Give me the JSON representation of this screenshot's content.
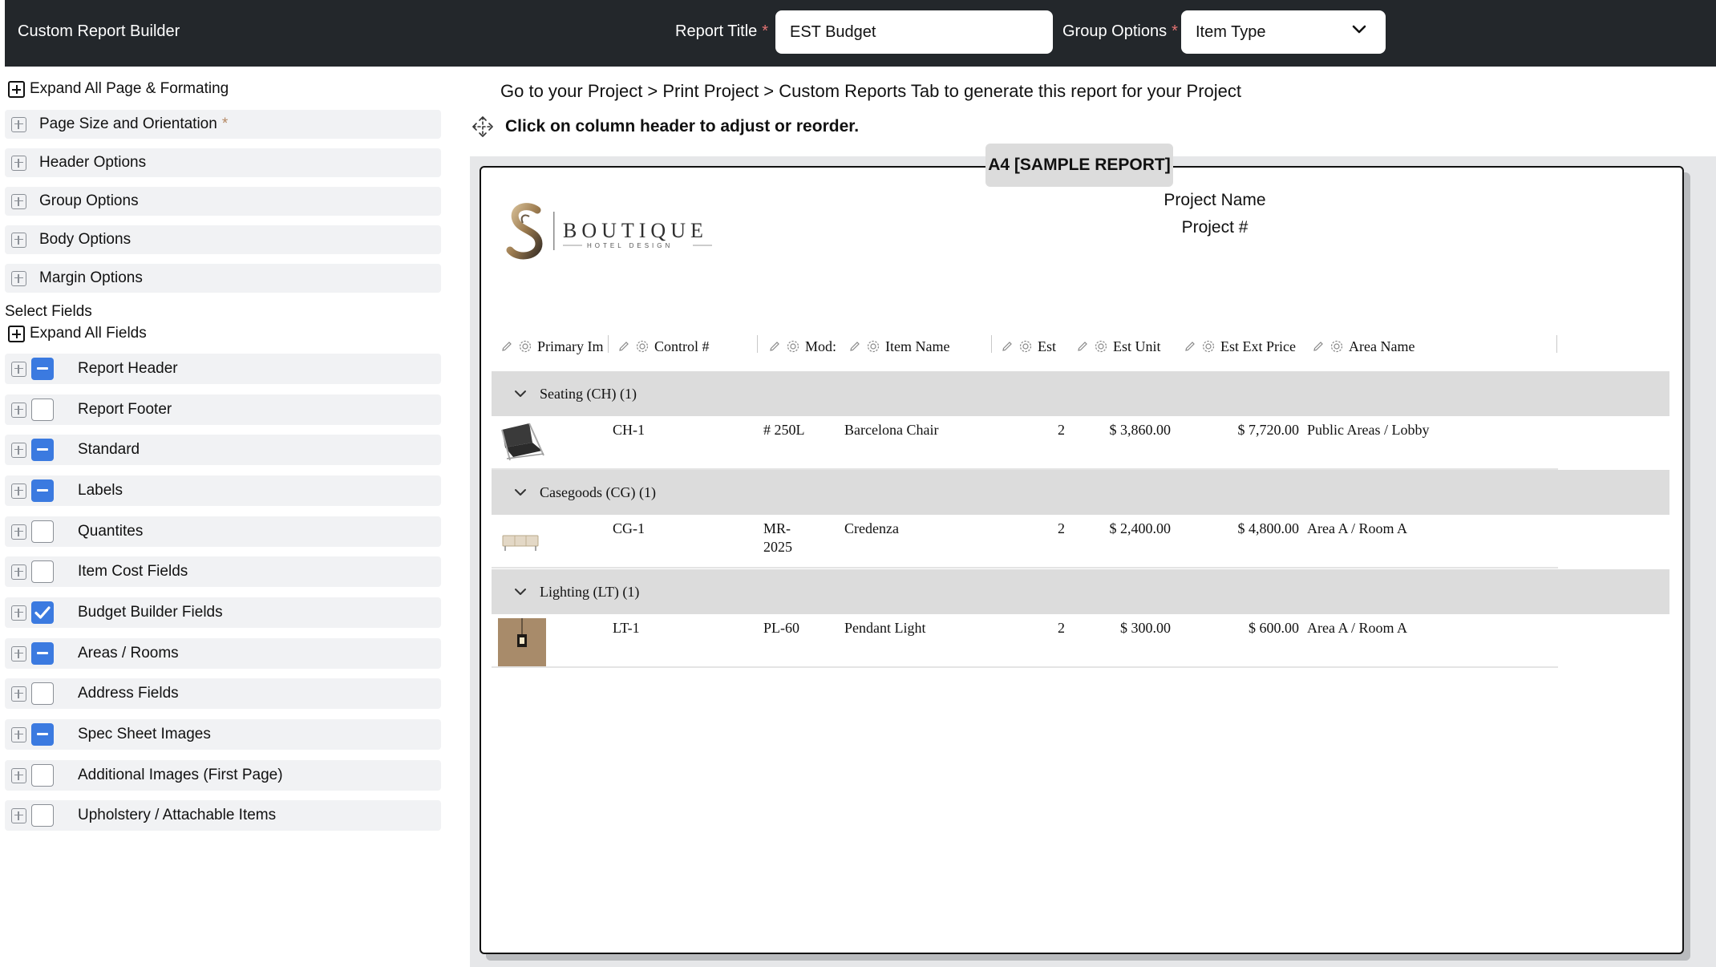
{
  "app": {
    "title": "Custom Report Builder"
  },
  "header": {
    "report_title_label": "Report Title",
    "report_title_value": "EST Budget",
    "group_options_label": "Group Options",
    "group_options_value": "Item Type",
    "required_mark": "*"
  },
  "sidebar": {
    "expand_page_label": "Expand All Page & Formating",
    "sections": [
      {
        "label": "Page Size and Orientation",
        "required": "*"
      },
      {
        "label": "Header Options"
      },
      {
        "label": "Group Options"
      },
      {
        "label": "Body Options"
      },
      {
        "label": "Margin Options"
      }
    ],
    "select_fields_title": "Select Fields",
    "expand_fields_label": "Expand All Fields",
    "fields": [
      {
        "label": "Report Header",
        "state": "partial"
      },
      {
        "label": "Report Footer",
        "state": "none"
      },
      {
        "label": "Standard",
        "state": "partial"
      },
      {
        "label": "Labels",
        "state": "partial"
      },
      {
        "label": "Quantites",
        "state": "none"
      },
      {
        "label": "Item Cost Fields",
        "state": "none"
      },
      {
        "label": "Budget Builder Fields",
        "state": "checked"
      },
      {
        "label": "Areas / Rooms",
        "state": "partial"
      },
      {
        "label": "Address Fields",
        "state": "none"
      },
      {
        "label": "Spec Sheet Images",
        "state": "partial"
      },
      {
        "label": "Additional Images (First Page)",
        "state": "none"
      },
      {
        "label": "Upholstery / Attachable Items",
        "state": "none"
      }
    ]
  },
  "main": {
    "info_text": "Go to your Project > Print Project > Custom Reports Tab to generate this report for your Project",
    "hint_text": "Click on column header to adjust or reorder.",
    "paper_label": "A4 [SAMPLE REPORT]"
  },
  "report": {
    "logo_text": "BOUTIQUE",
    "logo_subtext": "HOTEL DESIGN",
    "project_name": "Project Name",
    "project_number": "Project #",
    "columns": [
      "Primary Im",
      "Control #",
      "Mod:",
      "Item Name",
      "Est",
      "Est Unit",
      "Est Ext Price",
      "Area Name"
    ],
    "groups": [
      {
        "label": "Seating (CH) (1)",
        "rows": [
          {
            "image": "barcelona-chair-thumb",
            "control": "CH-1",
            "model": "# 250L",
            "item_name": "Barcelona Chair",
            "qty": "2",
            "unit": "$ 3,860.00",
            "ext": "$ 7,720.00",
            "area": "Public Areas / Lobby"
          }
        ]
      },
      {
        "label": "Casegoods (CG) (1)",
        "rows": [
          {
            "image": "credenza-thumb",
            "control": "CG-1",
            "model": "MR-2025",
            "model_line1": "MR-",
            "model_line2": "2025",
            "item_name": "Credenza",
            "qty": "2",
            "unit": "$ 2,400.00",
            "ext": "$ 4,800.00",
            "area": "Area A / Room A"
          }
        ]
      },
      {
        "label": "Lighting (LT) (1)",
        "rows": [
          {
            "image": "pendant-light-thumb",
            "control": "LT-1",
            "model": "PL-60",
            "item_name": "Pendant Light",
            "qty": "2",
            "unit": "$ 300.00",
            "ext": "$ 600.00",
            "area": "Area A / Room A"
          }
        ]
      }
    ]
  }
}
